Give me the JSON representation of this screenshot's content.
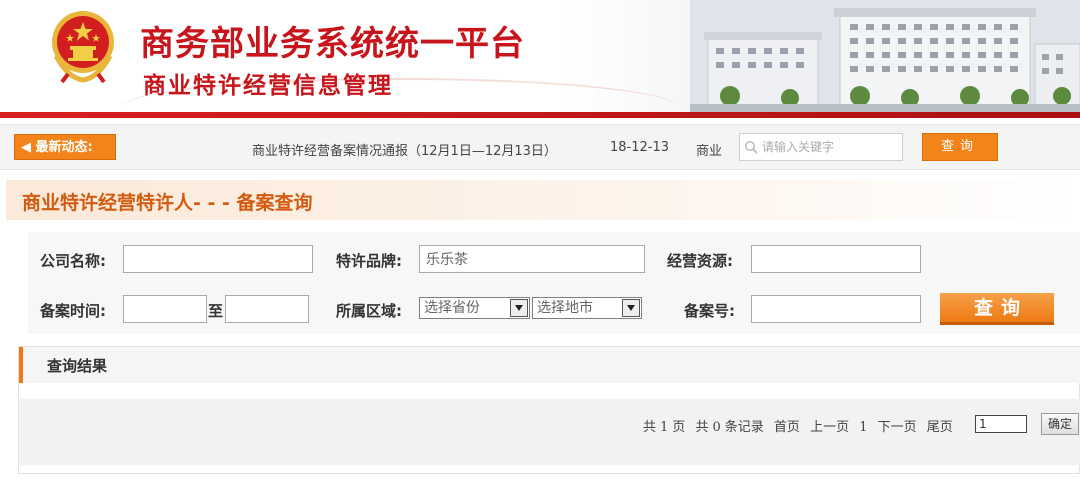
{
  "header": {
    "title": "商务部业务系统统一平台",
    "subtitle": "商业特许经营信息管理"
  },
  "news": {
    "badge_label": "最新动态:",
    "headline": "商业特许经营备案情况通报（12月1日—12月13日）",
    "date": "18-12-13",
    "next_fragment": "商业",
    "keyword_placeholder": "请输入关键字",
    "search_label": "查询"
  },
  "section": {
    "title": "商业特许经营特许人- - - 备案查询"
  },
  "form": {
    "company_label": "公司名称:",
    "company_value": "",
    "brand_label": "特许品牌:",
    "brand_value": "乐乐茶",
    "resource_label": "经营资源:",
    "resource_value": "",
    "date_label": "备案时间:",
    "date_from": "",
    "date_to_label": "至",
    "date_to": "",
    "region_label": "所属区域:",
    "province_selected": "选择省份",
    "city_selected": "选择地市",
    "record_no_label": "备案号:",
    "record_no_value": "",
    "query_label": "查询"
  },
  "results": {
    "title": "查询结果",
    "pager": {
      "total_pages_prefix": "共",
      "total_pages": "1",
      "total_pages_suffix": "页",
      "total_records_prefix": "共",
      "total_records": "0",
      "total_records_suffix": "条记录",
      "first": "首页",
      "prev": "上一页",
      "current": "1",
      "next": "下一页",
      "last": "尾页",
      "page_input": "1",
      "confirm": "确定"
    }
  },
  "colors": {
    "brand_red": "#c8151b",
    "accent_orange": "#f2841a",
    "section_orange": "#d35b0f"
  }
}
